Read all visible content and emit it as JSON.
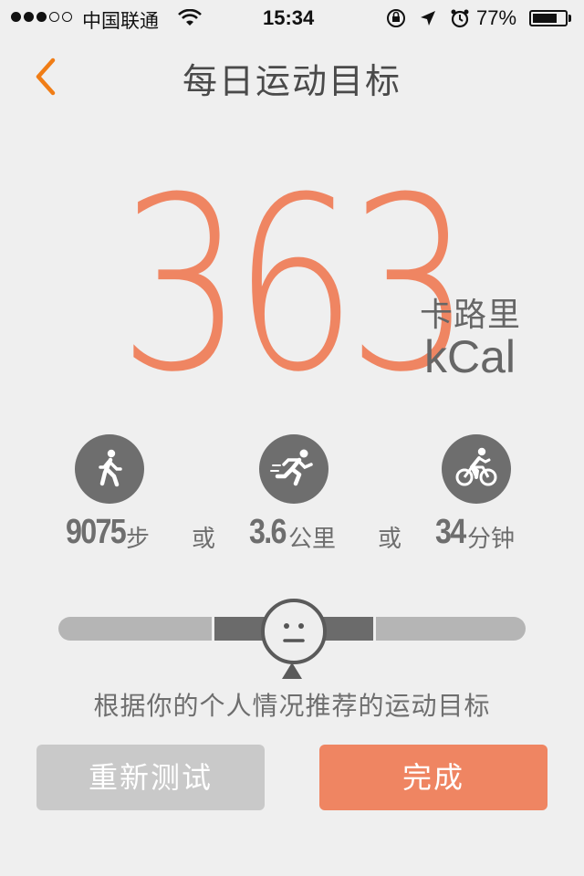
{
  "status_bar": {
    "carrier": "中国联通",
    "time": "15:34",
    "battery_percent": "77%",
    "battery_level": 0.77
  },
  "header": {
    "title": "每日运动目标"
  },
  "goal": {
    "calories": "363",
    "unit_cn": "卡路里",
    "unit_en": "kCal"
  },
  "activities": [
    {
      "icon": "walking-icon",
      "value": "9075",
      "unit": "步"
    },
    {
      "icon": "running-icon",
      "value": "3.6",
      "unit": "公里"
    },
    {
      "icon": "cycling-icon",
      "value": "34",
      "unit": "分钟"
    }
  ],
  "or_label": "或",
  "slider": {
    "level": 0.5
  },
  "hint": "根据你的个人情况推荐的运动目标",
  "buttons": {
    "retest": "重新测试",
    "done": "完成"
  },
  "colors": {
    "accent": "#ef8562",
    "back_arrow": "#f07d16",
    "icon_bg": "#6e6e6e"
  }
}
